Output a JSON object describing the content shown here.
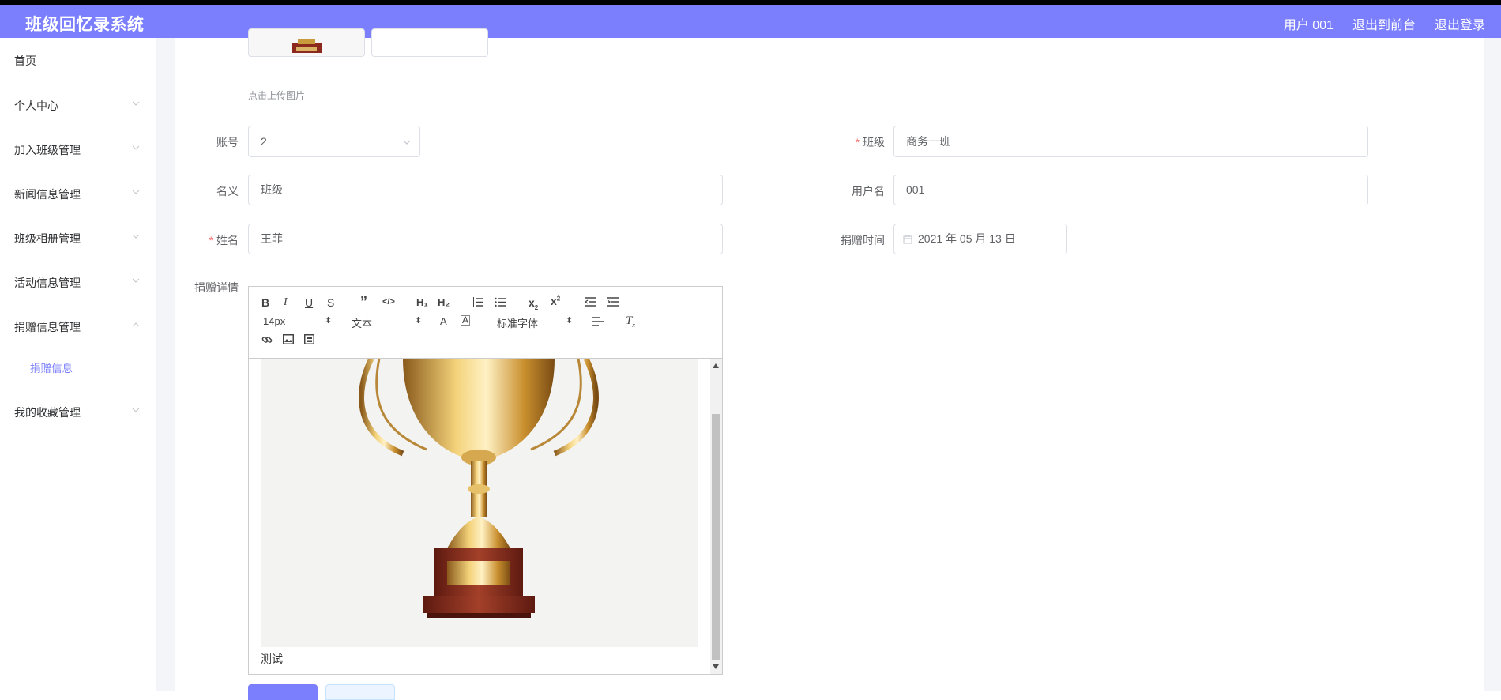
{
  "app": {
    "title": "班级回忆录系统"
  },
  "topnav": {
    "user": "用户 001",
    "to_front": "退出到前台",
    "logout": "退出登录"
  },
  "sidebar": {
    "items": [
      {
        "label": "首页"
      },
      {
        "label": "个人中心"
      },
      {
        "label": "加入班级管理"
      },
      {
        "label": "新闻信息管理"
      },
      {
        "label": "班级相册管理"
      },
      {
        "label": "活动信息管理"
      },
      {
        "label": "捐赠信息管理"
      },
      {
        "label": "我的收藏管理"
      }
    ],
    "active_sub": "捐赠信息"
  },
  "form": {
    "upload_hint": "点击上传图片",
    "account": {
      "label": "账号",
      "value": "2"
    },
    "class": {
      "label": "班级",
      "value": "商务一班",
      "required": true
    },
    "name_yi": {
      "label": "名义",
      "value": "班级"
    },
    "username": {
      "label": "用户名",
      "value": "001"
    },
    "fullname": {
      "label": "姓名",
      "value": "王菲",
      "required": true
    },
    "donate_time": {
      "label": "捐赠时间",
      "value": "2021 年 05 月 13 日"
    },
    "detail": {
      "label": "捐赠详情"
    }
  },
  "editor": {
    "font_size": "14px",
    "block_type": "文本",
    "font_family": "标准字体",
    "content_text": "测试"
  },
  "colors": {
    "accent": "#7b7ffd",
    "required": "#f56c6c"
  }
}
